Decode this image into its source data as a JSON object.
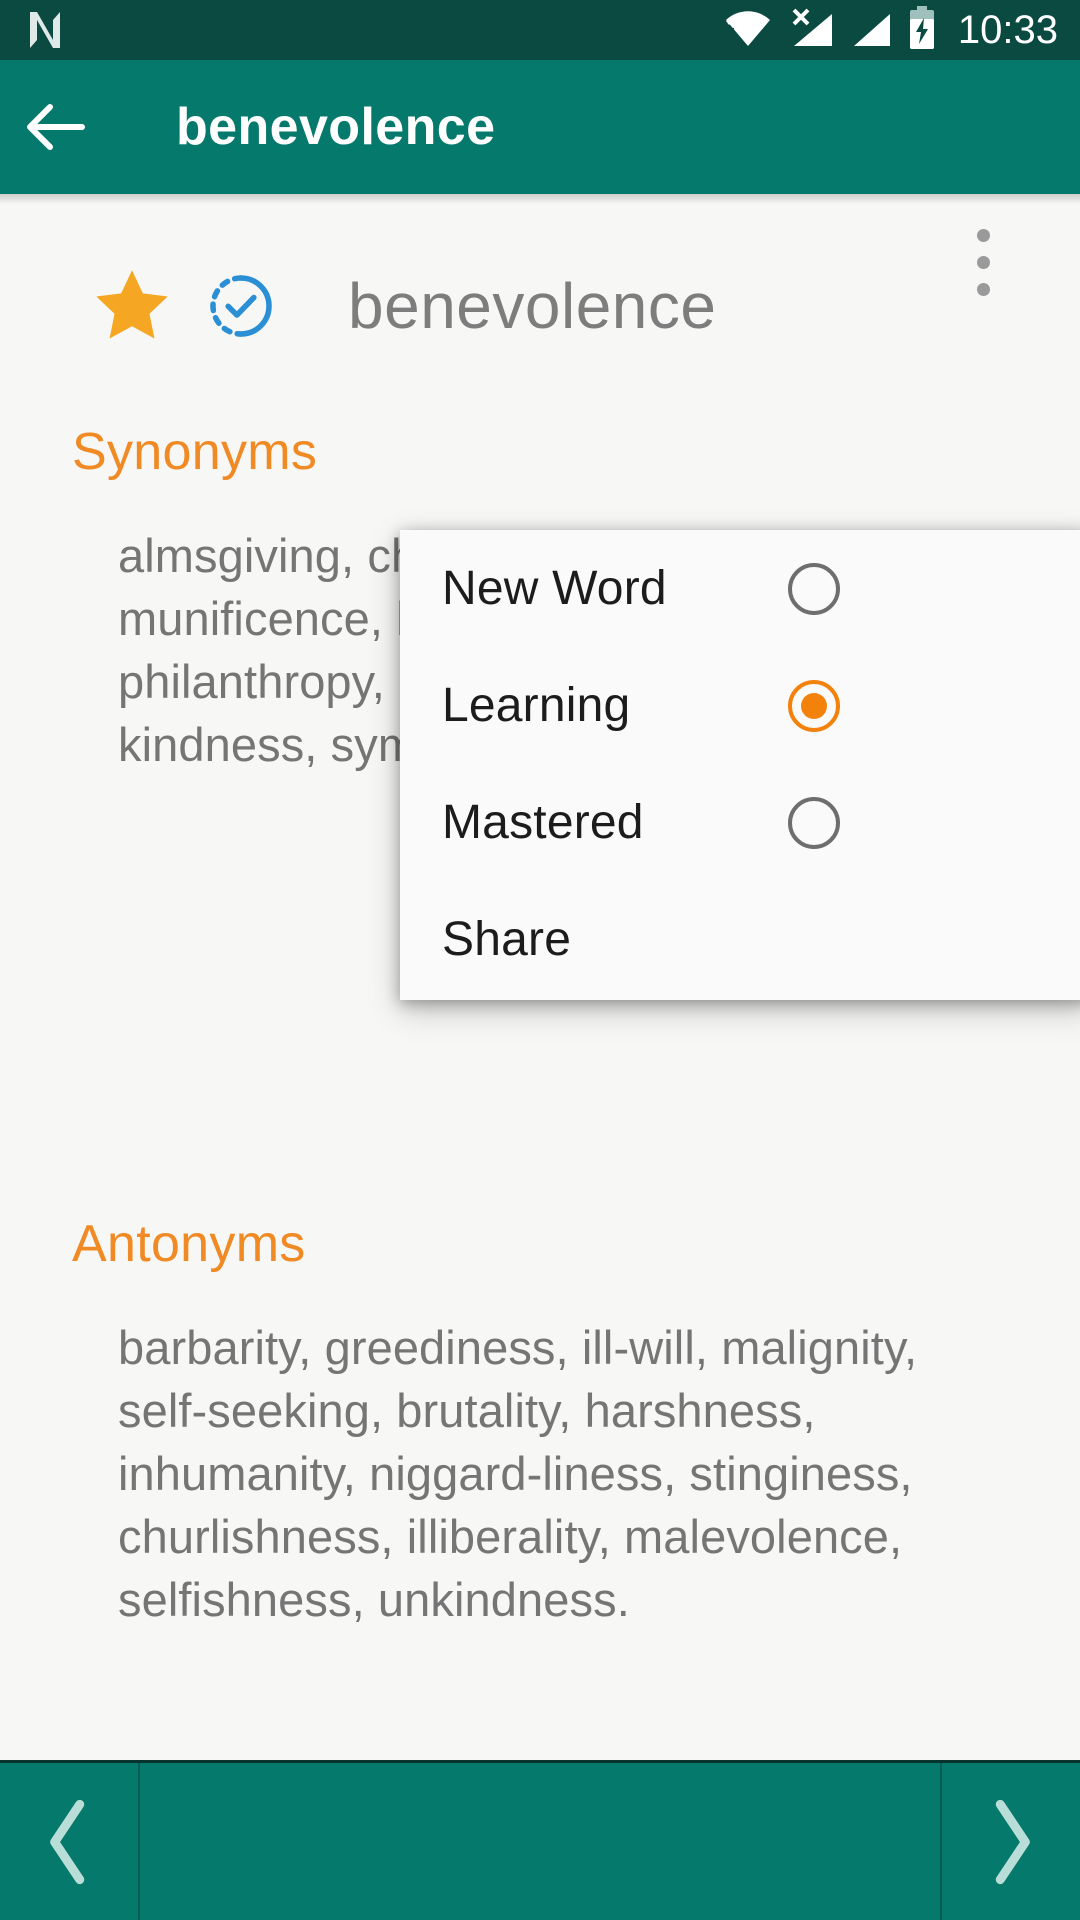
{
  "status_bar": {
    "logo_icon": "android-n-logo-icon",
    "wifi_icon": "wifi-icon",
    "signal1_icon": "signal-no-sim-icon",
    "signal2_icon": "signal-bars-icon",
    "battery_icon": "battery-charging-icon",
    "time": "10:33",
    "background_color": "#0a4a41"
  },
  "app_bar": {
    "back_icon": "back-arrow-icon",
    "title": "benevolence",
    "background_color": "#05796c",
    "text_color": "#ffffff"
  },
  "word_header": {
    "star_icon": "star-filled-icon",
    "star_color": "#f5a623",
    "progress_icon": "check-circle-dashed-icon",
    "progress_color": "#2a8fd4",
    "word": "benevolence",
    "overflow_icon": "more-vertical-icon"
  },
  "sections": [
    {
      "id": "synonyms",
      "heading": "Synonyms",
      "heading_color": "#f08a24",
      "body": "almsgiving, charity, kind-heartedness, munificence, beneficence, generosity, philanthropy, benignity, good-will, kindness, sympathy, humanity, liberality."
    },
    {
      "id": "antonyms",
      "heading": "Antonyms",
      "heading_color": "#f08a24",
      "body": "barbarity, greediness, ill-will, malignity, self-seeking, brutality, harshness, inhumanity, niggard-liness, stinginess, churlishness, illiberality, malevolence, selfishness, unkindness."
    }
  ],
  "overflow_menu": {
    "visible": true,
    "selected_color": "#f2820c",
    "items": [
      {
        "label": "New Word",
        "type": "radio",
        "selected": false
      },
      {
        "label": "Learning",
        "type": "radio",
        "selected": true
      },
      {
        "label": "Mastered",
        "type": "radio",
        "selected": false
      },
      {
        "label": "Share",
        "type": "action",
        "selected": false
      }
    ]
  },
  "bottom_nav": {
    "prev_icon": "chevron-left-icon",
    "next_icon": "chevron-right-icon",
    "background_color": "#05796c"
  }
}
